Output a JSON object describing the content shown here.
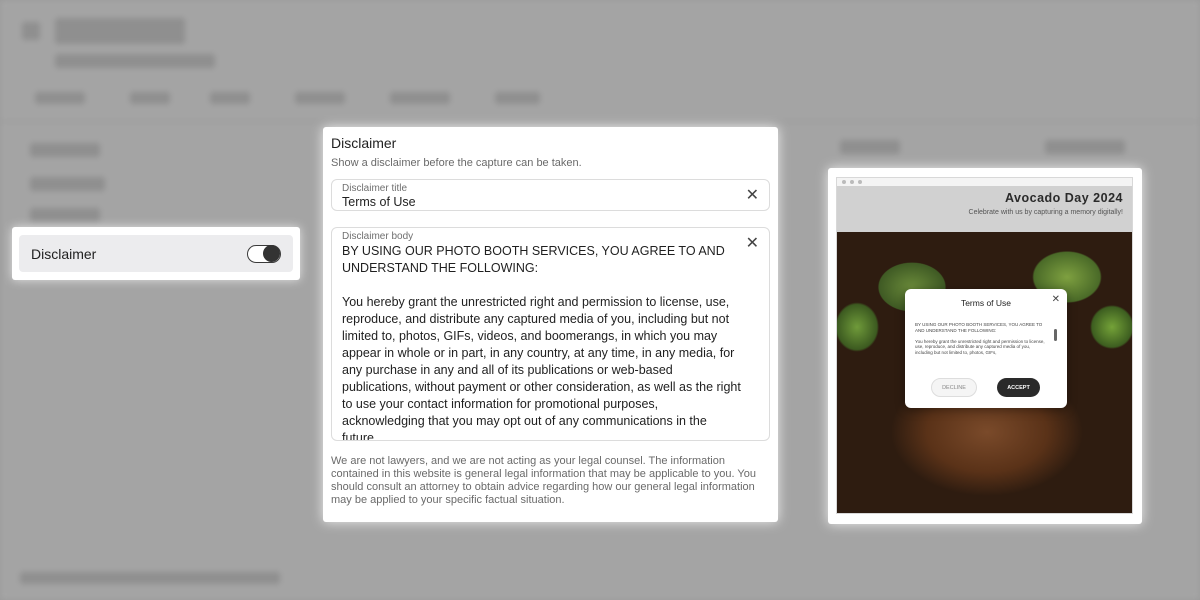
{
  "settings": {
    "toggle_label": "Disclaimer",
    "toggle_on": true
  },
  "panel": {
    "title": "Disclaimer",
    "subtitle": "Show a disclaimer before the capture can be taken.",
    "title_field": {
      "label": "Disclaimer title",
      "value": "Terms of Use"
    },
    "body_field": {
      "label": "Disclaimer body",
      "value": "BY USING OUR PHOTO BOOTH SERVICES, YOU AGREE TO AND UNDERSTAND THE FOLLOWING:\n\nYou hereby grant the unrestricted right and permission to license, use, reproduce, and distribute any captured media of you, including but not limited to, photos, GIFs, videos, and boomerangs, in which you may appear in whole or in part, in any country, at any time, in any media, for any purchase in any and all of its publications or web-based publications, without payment or other consideration, as well as the right to use your contact information for promotional purposes, acknowledging that you may opt out of any communications in the future."
    },
    "legal_note": "We are not lawyers, and we are not acting as your legal counsel. The information contained in this website is general legal information that may be applicable to you. You should consult an attorney to obtain advice regarding how our general legal information may be applied to your specific factual situation."
  },
  "preview": {
    "event_title": "Avocado Day 2024",
    "event_subtitle": "Celebrate with us by capturing a memory digitally!",
    "modal": {
      "title": "Terms of Use",
      "body": "BY USING OUR PHOTO BOOTH SERVICES, YOU AGREE TO AND UNDERSTAND THE FOLLOWING:\n\nYou hereby grant the unrestricted right and permission to license, use, reproduce, and distribute any captured media of you, including but not limited to, photos, GIFs,",
      "decline_label": "DECLINE",
      "accept_label": "ACCEPT"
    }
  },
  "icons": {
    "clear": "close-icon",
    "modal_close": "close-icon"
  }
}
